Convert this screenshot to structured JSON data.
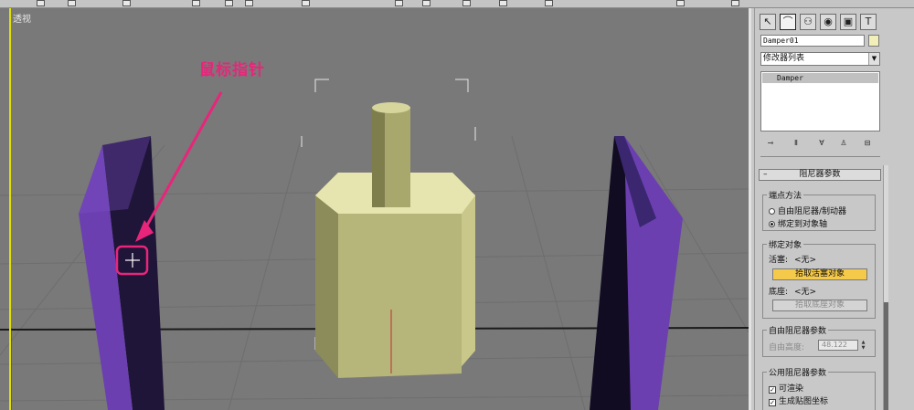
{
  "viewport": {
    "label": "透视",
    "annotation": "鼠标指针",
    "colors": {
      "background": "#797979",
      "plate": "#1e1538",
      "plate_edge": "#6b3fb0",
      "cylinder": "#c9c88a",
      "annotation": "#e8257a"
    }
  },
  "panel": {
    "tabs": [
      "create-icon",
      "modify-icon",
      "hierarchy-icon",
      "motion-icon",
      "display-icon",
      "utilities-icon"
    ],
    "object_name": "Damper01",
    "modifier_list": "修改器列表",
    "stack_items": [
      "Damper"
    ],
    "rollout_title": "阻尼器参数",
    "endpoint_group": "端点方法",
    "endpoint_options": [
      "自由阻尼器/制动器",
      "绑定到对象轴"
    ],
    "endpoint_selected": 1,
    "bind_group": "绑定对象",
    "piston_label": "活塞:",
    "piston_value": "<无>",
    "pick_piston": "拾取活塞对象",
    "base_label": "底座:",
    "base_value": "<无>",
    "pick_base": "拾取底座对象",
    "free_group": "自由阻尼器参数",
    "free_height_label": "自由高度:",
    "free_height_value": "48.122",
    "common_group": "公用阻尼器参数",
    "renderable": "可渲染",
    "gen_map_coords": "生成贴图坐标"
  }
}
